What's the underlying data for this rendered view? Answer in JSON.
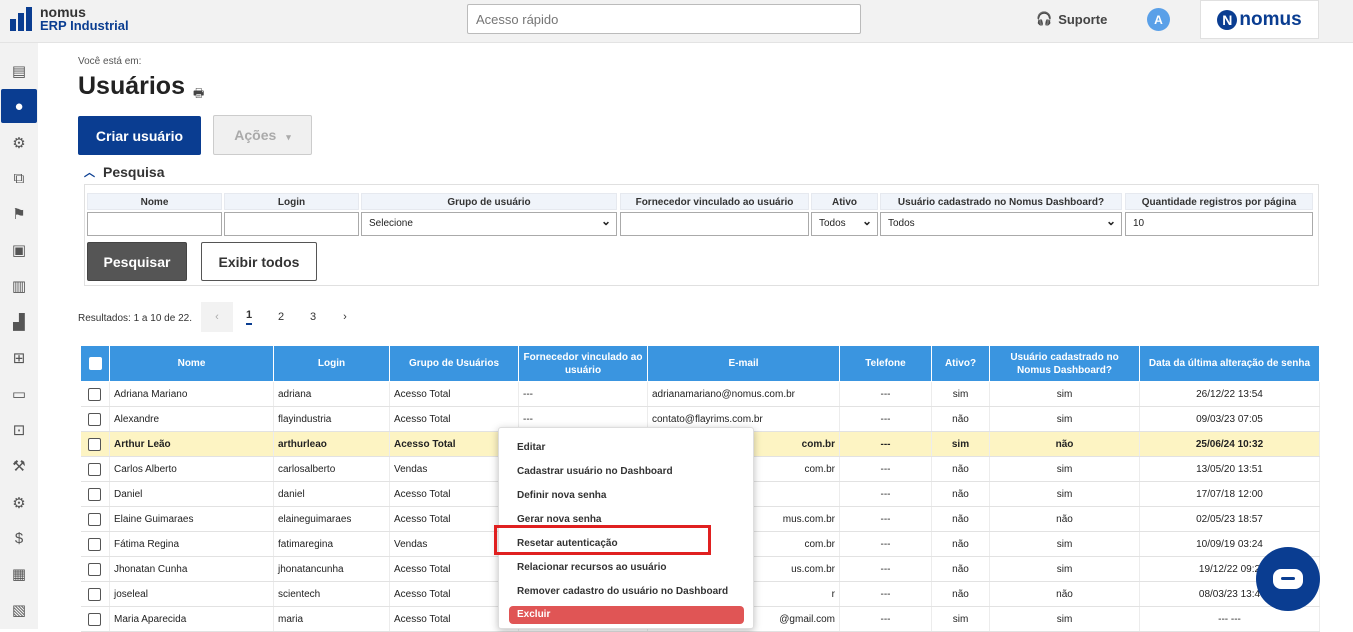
{
  "header": {
    "logo_line1": "nomus",
    "logo_line2": "ERP Industrial",
    "quick_access_placeholder": "Acesso rápido",
    "support_label": "Suporte",
    "avatar_initial": "A",
    "brand_letter": "N",
    "brand_name": "nomus"
  },
  "sidebar": {
    "items": [
      {
        "icon": "book-icon",
        "glyph": "▤"
      },
      {
        "icon": "user-icon",
        "glyph": "👤",
        "active": true
      },
      {
        "icon": "gear-icon",
        "glyph": "⚙"
      },
      {
        "icon": "hierarchy-icon",
        "glyph": "⧉"
      },
      {
        "icon": "bookmark-check-icon",
        "glyph": "⚑"
      },
      {
        "icon": "briefcase-icon",
        "glyph": "▣"
      },
      {
        "icon": "receipt-icon",
        "glyph": "▥"
      },
      {
        "icon": "factory-icon",
        "glyph": "▟"
      },
      {
        "icon": "truck-icon",
        "glyph": "⊞"
      },
      {
        "icon": "archive-icon",
        "glyph": "▭"
      },
      {
        "icon": "cart-icon",
        "glyph": "⊡"
      },
      {
        "icon": "robot-arm-icon",
        "glyph": "⚒"
      },
      {
        "icon": "gears-icon",
        "glyph": "⚙"
      },
      {
        "icon": "dollar-icon",
        "glyph": "$"
      },
      {
        "icon": "calculator-icon",
        "glyph": "▦"
      },
      {
        "icon": "invoice-icon",
        "glyph": "▧"
      }
    ]
  },
  "page": {
    "breadcrumb": "Você está em:",
    "title": "Usuários",
    "create_button": "Criar usuário",
    "actions_button": "Ações",
    "search_toggle": "Pesquisa"
  },
  "search": {
    "labels": {
      "nome": "Nome",
      "login": "Login",
      "grupo": "Grupo de usuário",
      "fornecedor": "Fornecedor vinculado ao usuário",
      "ativo": "Ativo",
      "dashboard": "Usuário cadastrado no Nomus Dashboard?",
      "quantidade": "Quantidade registros por página"
    },
    "values": {
      "grupo": "Selecione",
      "ativo": "Todos",
      "dashboard": "Todos",
      "quantidade": "10"
    },
    "search_button": "Pesquisar",
    "show_all_button": "Exibir todos"
  },
  "results": {
    "text": "Resultados: 1 a 10 de 22.",
    "prev": "‹",
    "pages": [
      "1",
      "2",
      "3"
    ],
    "next": "›"
  },
  "table": {
    "headers": [
      "Nome",
      "Login",
      "Grupo de Usuários",
      "Fornecedor vinculado ao usuário",
      "E-mail",
      "Telefone",
      "Ativo?",
      "Usuário cadastrado no Nomus Dashboard?",
      "Data da última alteração de senha"
    ],
    "rows": [
      [
        "Adriana Mariano",
        "adriana",
        "Acesso Total",
        "---",
        "adrianamariano@nomus.com.br",
        "---",
        "sim",
        "sim",
        "26/12/22 13:54"
      ],
      [
        "Alexandre",
        "flayindustria",
        "Acesso Total",
        "---",
        "contato@flayrims.com.br",
        "---",
        "não",
        "sim",
        "09/03/23 07:05"
      ],
      [
        "Arthur Leão",
        "arthurleao",
        "Acesso Total",
        "",
        "com.br",
        "---",
        "sim",
        "não",
        "25/06/24 10:32"
      ],
      [
        "Carlos Alberto",
        "carlosalberto",
        "Vendas",
        "",
        "com.br",
        "---",
        "não",
        "sim",
        "13/05/20 13:51"
      ],
      [
        "Daniel",
        "daniel",
        "Acesso Total",
        "",
        "",
        "---",
        "não",
        "sim",
        "17/07/18 12:00"
      ],
      [
        "Elaine Guimaraes",
        "elaineguimaraes",
        "Acesso Total",
        "",
        "mus.com.br",
        "---",
        "não",
        "não",
        "02/05/23 18:57"
      ],
      [
        "Fátima Regina",
        "fatimaregina",
        "Vendas",
        "",
        "com.br",
        "---",
        "não",
        "sim",
        "10/09/19 03:24"
      ],
      [
        "Jhonatan Cunha",
        "jhonatancunha",
        "Acesso Total",
        "",
        "us.com.br",
        "---",
        "não",
        "sim",
        "19/12/22 09:2"
      ],
      [
        "joseleal",
        "scientech",
        "Acesso Total",
        "",
        "r",
        "---",
        "não",
        "não",
        "08/03/23 13:4"
      ],
      [
        "Maria Aparecida",
        "maria",
        "Acesso Total",
        "",
        "@gmail.com",
        "---",
        "sim",
        "sim",
        "--- ---"
      ]
    ]
  },
  "context_menu": {
    "items": [
      "Editar",
      "Cadastrar usuário no Dashboard",
      "Definir nova senha",
      "Gerar nova senha",
      "Resetar autenticação",
      "Relacionar recursos ao usuário",
      "Remover cadastro do usuário no Dashboard"
    ],
    "delete": "Excluir"
  },
  "colors": {
    "primary": "#0a3d91",
    "table_header": "#3a95e0",
    "highlight_row": "#fdf4c3",
    "danger": "#e05555",
    "callout": "#e02020"
  }
}
